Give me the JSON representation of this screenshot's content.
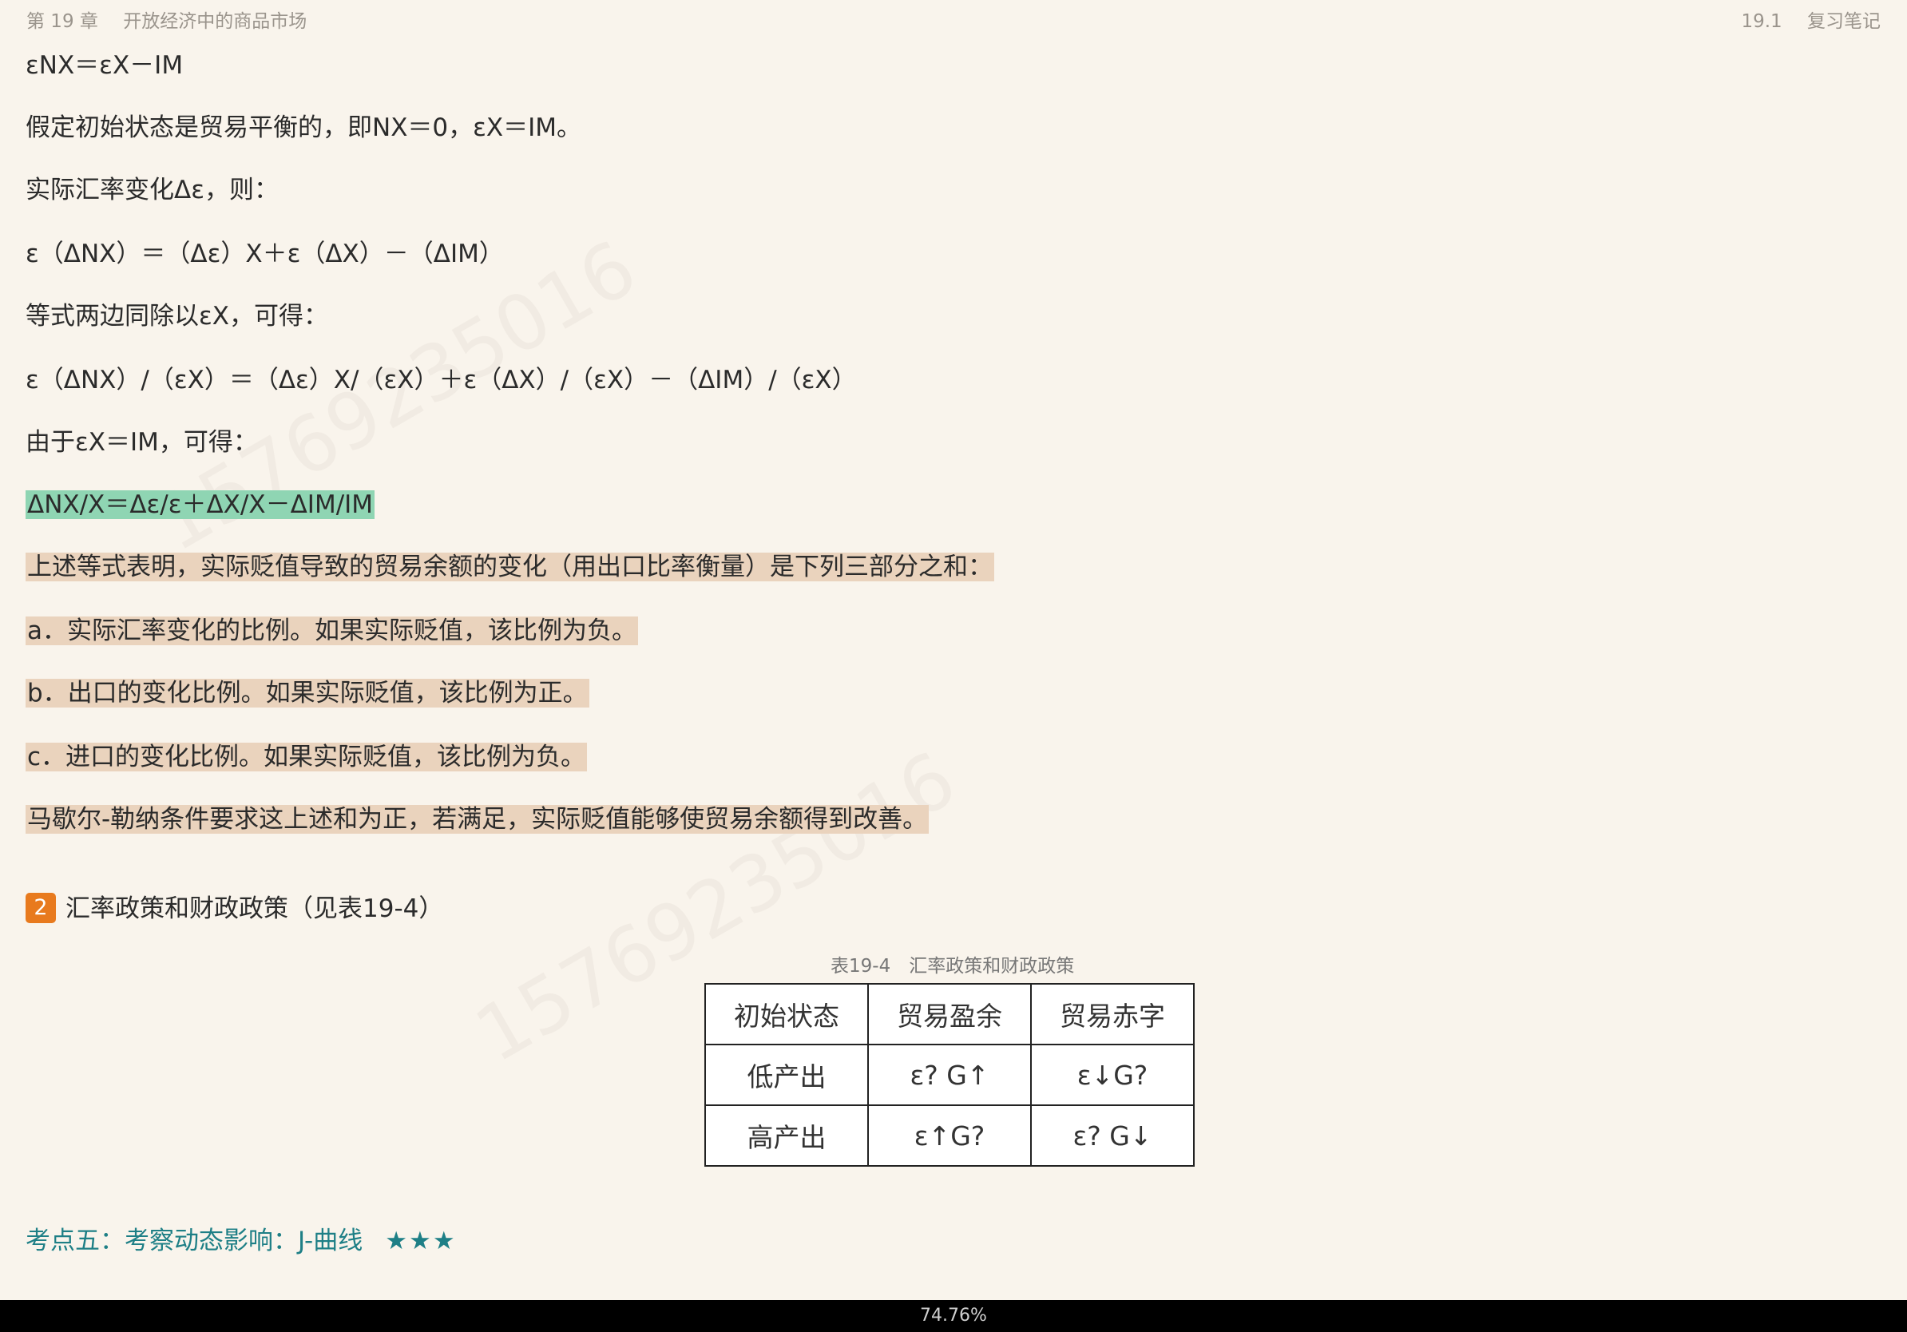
{
  "header": {
    "chapter": "第 19 章",
    "chapter_title": "开放经济中的商品市场",
    "section": "19.1",
    "section_title": "复习笔记"
  },
  "lines": [
    "εNX＝εX－IM",
    "假定初始状态是贸易平衡的，即NX＝0，εX＝IM。",
    "实际汇率变化Δε，则：",
    "ε（ΔNX）＝（Δε）X＋ε（ΔX）－（ΔIM）",
    "等式两边同除以εX，可得：",
    "ε（ΔNX）/（εX）＝（Δε）X/（εX）＋ε（ΔX）/（εX）－（ΔIM）/（εX）",
    "由于εX＝IM，可得：",
    "ΔNX/X＝Δε/ε＋ΔX/X－ΔIM/IM",
    "上述等式表明，实际贬值导致的贸易余额的变化（用出口比率衡量）是下列三部分之和：",
    "a．实际汇率变化的比例。如果实际贬值，该比例为负。",
    "b．出口的变化比例。如果实际贬值，该比例为正。",
    "c．进口的变化比例。如果实际贬值，该比例为负。",
    "马歇尔-勒纳条件要求这上述和为正，若满足，实际贬值能够使贸易余额得到改善。"
  ],
  "section2": {
    "number": "2",
    "title": "汇率政策和财政政策（见表19-4）"
  },
  "table": {
    "caption": "表19-4　汇率政策和财政政策",
    "header": [
      "初始状态",
      "贸易盈余",
      "贸易赤字"
    ],
    "rows": [
      [
        "低产出",
        "ε? G↑",
        "ε↓G?"
      ],
      [
        "高产出",
        "ε↑G?",
        "ε? G↓"
      ]
    ]
  },
  "kaodian": {
    "label": "考点五：考察动态影响：J-曲线",
    "stars": "★★★"
  },
  "watermark": "15769235016",
  "footer": {
    "progress": "74.76%"
  },
  "colors": {
    "highlight_green": "#8fd5b3",
    "highlight_tan": "#ead3bd",
    "accent_teal": "#1e7f86",
    "badge_orange": "#e87a1e"
  }
}
